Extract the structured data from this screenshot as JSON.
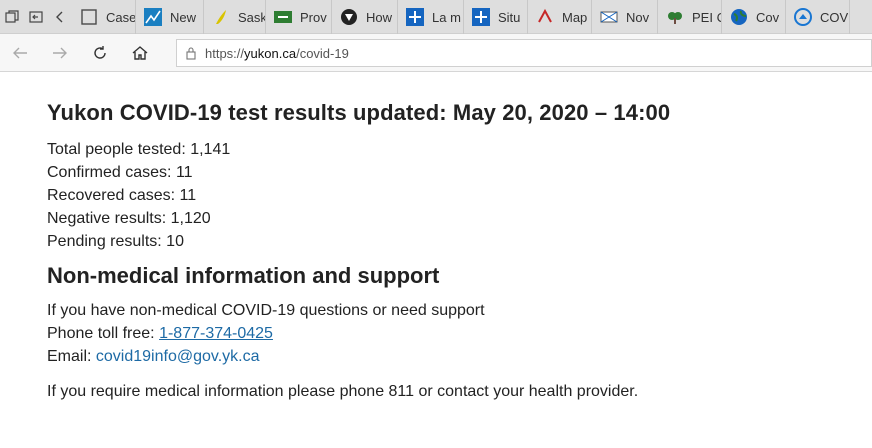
{
  "tabs": [
    {
      "title": "Case",
      "icon": "cases-icon",
      "color": "#4a4a4a"
    },
    {
      "title": "New",
      "icon": "chart-icon",
      "color": "#1a7fc1"
    },
    {
      "title": "Sask",
      "icon": "saskatchewan-icon",
      "color": "#d9c400"
    },
    {
      "title": "Prov",
      "icon": "province-flag-icon",
      "color": "#2e7d32"
    },
    {
      "title": "How",
      "icon": "shield-icon",
      "color": "#222222"
    },
    {
      "title": "La m",
      "icon": "quebec-icon",
      "color": "#1565c0"
    },
    {
      "title": "Situ",
      "icon": "quebec-icon",
      "color": "#1565c0"
    },
    {
      "title": "Map",
      "icon": "map-icon",
      "color": "#c62828"
    },
    {
      "title": "Nov",
      "icon": "nova-scotia-icon",
      "color": "#555555"
    },
    {
      "title": "PEI C",
      "icon": "pei-icon",
      "color": "#2e7d32"
    },
    {
      "title": "Cov",
      "icon": "globe-icon",
      "color": "#2e7d32"
    },
    {
      "title": "COV",
      "icon": "covid-icon",
      "color": "#1976d2"
    }
  ],
  "address_bar": {
    "url_prefix": "https://",
    "url_host": "yukon.ca",
    "url_path": "/covid-19"
  },
  "page": {
    "heading": "Yukon COVID-19 test results updated: May 20, 2020 – 14:00",
    "stats": [
      "Total people tested: 1,141",
      "Confirmed cases: 11",
      "Recovered cases: 11",
      "Negative results: 1,120",
      "Pending results: 10"
    ],
    "support_heading": "Non-medical information and support",
    "support_intro": "If you have non-medical COVID-19 questions or need support",
    "phone_label": "Phone toll free: ",
    "phone_number": "1-877-374-0425",
    "email_label": "Email: ",
    "email_address": "covid19info@gov.yk.ca",
    "medical_note": "If you require medical information please phone 811 or contact your health provider."
  }
}
